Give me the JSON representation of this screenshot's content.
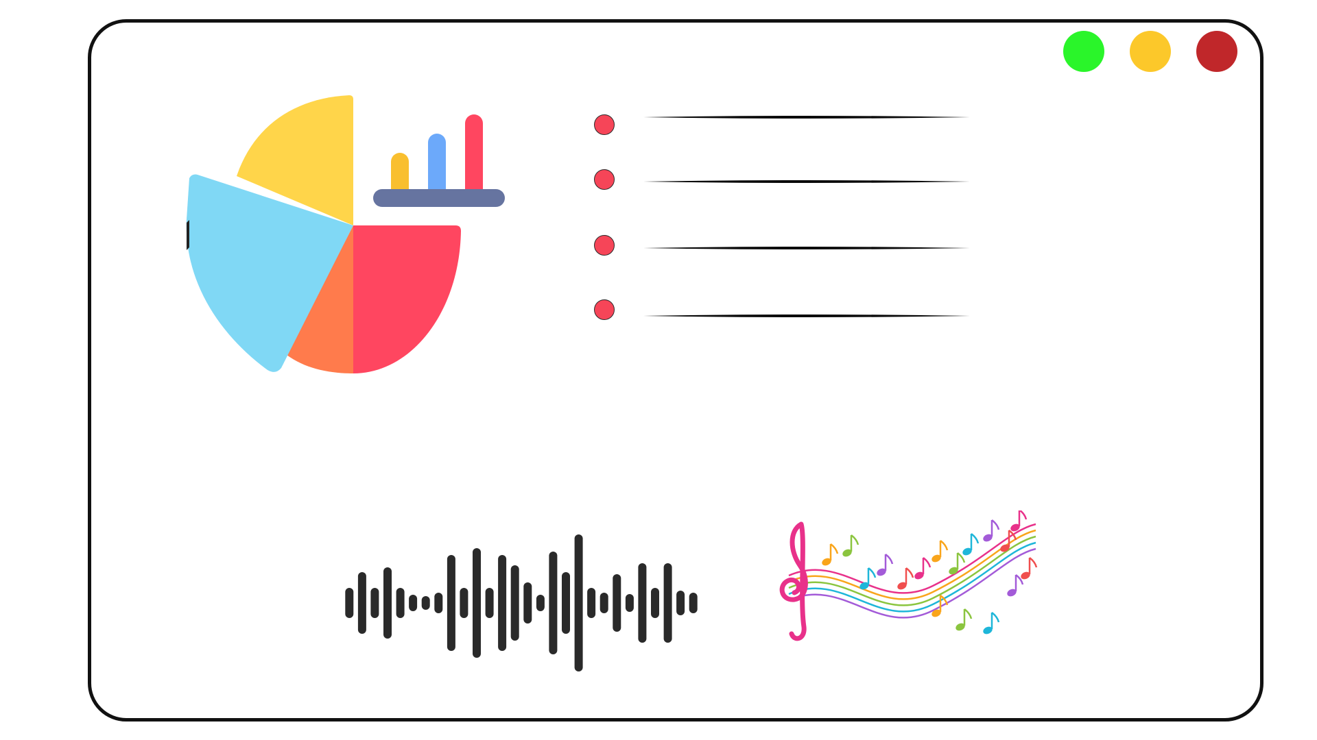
{
  "window": {
    "controls": [
      {
        "name": "maximize",
        "color": "#2af52a"
      },
      {
        "name": "minimize",
        "color": "#fcc82a"
      },
      {
        "name": "close",
        "color": "#c0272a"
      }
    ]
  },
  "analytics_icon": {
    "pie_colors": [
      "#ffd54a",
      "#ff4660",
      "#ff7b4c",
      "#80d8f5"
    ],
    "bar_colors": [
      "#f9bf2f",
      "#6ca9fa",
      "#ff4660"
    ],
    "base_color": "#6674a0"
  },
  "bullet_list": {
    "dot_color": "#f64558",
    "line_color": "#0a0a0a",
    "items": [
      {
        "text": ""
      },
      {
        "text": ""
      },
      {
        "text": ""
      },
      {
        "text": ""
      }
    ]
  },
  "waveform": {
    "color": "#2a2a2a",
    "levels": [
      0.22,
      0.45,
      0.22,
      0.52,
      0.22,
      0.12,
      0.1,
      0.15,
      0.7,
      0.22,
      0.8,
      0.22,
      0.7,
      0.55,
      0.3,
      0.12,
      0.75,
      0.45,
      1.0,
      0.22,
      0.15,
      0.42,
      0.13,
      0.58,
      0.22,
      0.58,
      0.18,
      0.15
    ]
  },
  "music_notes": {
    "colors": [
      "#e8318a",
      "#f9a51b",
      "#8bc53f",
      "#1eb6d9",
      "#a35bd8",
      "#f04e4e"
    ]
  }
}
